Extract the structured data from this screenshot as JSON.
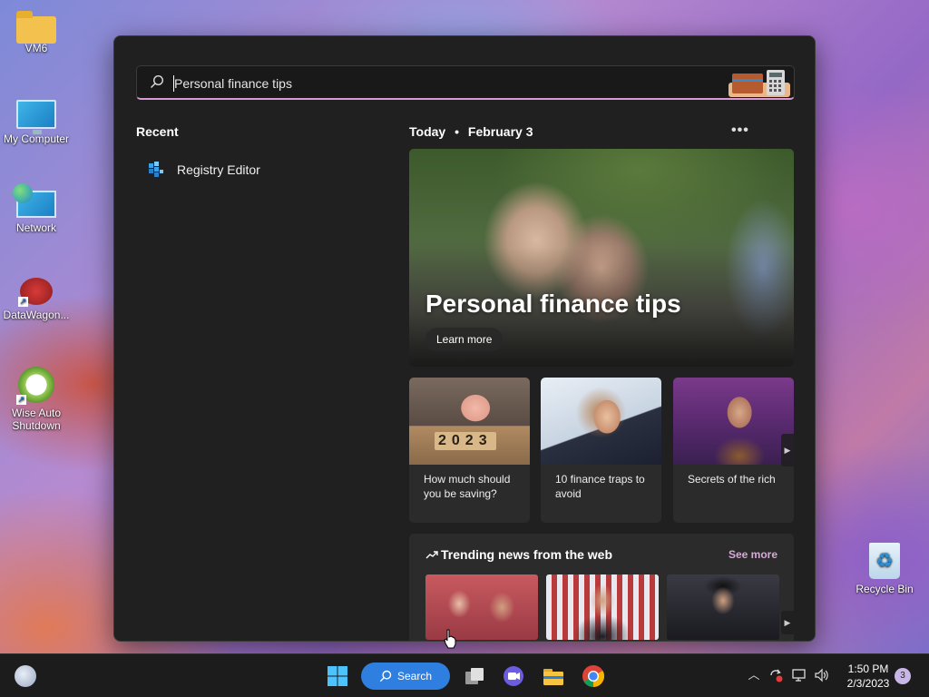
{
  "desktop": {
    "icons": [
      {
        "label": "VM6",
        "icon": "folder-icon"
      },
      {
        "label": "My Computer",
        "icon": "computer-icon"
      },
      {
        "label": "Network",
        "icon": "network-icon"
      },
      {
        "label": "DataWagon...",
        "icon": "datawagon-icon"
      },
      {
        "label": "Wise Auto Shutdown",
        "icon": "wise-auto-shutdown-icon"
      },
      {
        "label": "Recycle Bin",
        "icon": "recycle-bin-icon"
      }
    ]
  },
  "search": {
    "value": "Personal finance tips",
    "placeholder": "Personal finance tips"
  },
  "recent": {
    "heading": "Recent",
    "items": [
      {
        "label": "Registry Editor",
        "icon": "registry-editor-icon"
      }
    ]
  },
  "today": {
    "day": "Today",
    "date": "February 3",
    "more_label": "•••"
  },
  "hero": {
    "title": "Personal finance tips",
    "button": "Learn more"
  },
  "cards": [
    {
      "caption": "How much should you be saving?",
      "thumb_text": "2023"
    },
    {
      "caption": "10 finance traps to avoid"
    },
    {
      "caption": "Secrets of the rich"
    }
  ],
  "trending": {
    "title": "Trending news from the web",
    "see_more": "See more"
  },
  "taskbar": {
    "search_label": "Search",
    "time": "1:50 PM",
    "date": "2/3/2023",
    "notification_count": "3"
  },
  "colors": {
    "accent": "#2f7fe0",
    "search_underline": "#d89ad6",
    "panel_bg": "#202020",
    "card_bg": "#2b2b2b"
  }
}
